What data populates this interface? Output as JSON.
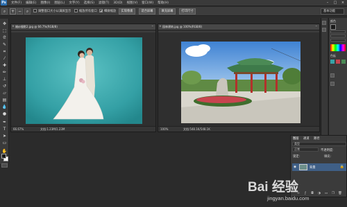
{
  "app": {
    "logo": "Ps"
  },
  "menu": [
    "文件(F)",
    "编辑(E)",
    "图像(I)",
    "图层(L)",
    "文字(Y)",
    "选择(S)",
    "滤镜(T)",
    "3D(D)",
    "视图(V)",
    "窗口(W)",
    "帮助(H)"
  ],
  "window_controls": [
    "–",
    "□",
    "×"
  ],
  "options_bar": {
    "checkboxes": [
      {
        "label": "调整窗口大小以满屏显示",
        "checked": false
      },
      {
        "label": "缩放所有窗口",
        "checked": false
      },
      {
        "label": "细微缩放",
        "checked": true
      }
    ],
    "buttons": [
      "实际像素",
      "适合屏幕",
      "填充屏幕",
      "打印尺寸"
    ],
    "workspace": "基本功能"
  },
  "documents": [
    {
      "tab_title": "婚纱摄影2.jpg @ 66.7%(RGB/8)",
      "zoom": "66.67%",
      "doc_info": "文档:1.23M/1.23M"
    },
    {
      "tab_title": "园林建筑.jpg @ 100%(RGB/8)",
      "zoom": "100%",
      "doc_info": "文档:548.1K/548.1K"
    }
  ],
  "layers_panel": {
    "tabs": [
      "图层",
      "通道",
      "路径"
    ],
    "kind_filter": "类型",
    "blend_mode": "正常",
    "opacity_label": "不透明度:",
    "lock_label": "锁定:",
    "fill_label": "填充:",
    "layer_name": "背景",
    "footer_icons": [
      "link-icon",
      "fx-icon",
      "mask-icon",
      "adjustment-icon",
      "folder-icon",
      "new-layer-icon",
      "trash-icon"
    ]
  },
  "right_panel": {
    "color_label": "颜色",
    "swatches_label": "色板"
  },
  "colors": {
    "teal_backdrop": "#37a3a7",
    "sky": "#4d8fd6",
    "roof": "#3e7a4a"
  },
  "watermark": {
    "logo": "Bai 经验",
    "url": "jingyan.baidu.com"
  }
}
